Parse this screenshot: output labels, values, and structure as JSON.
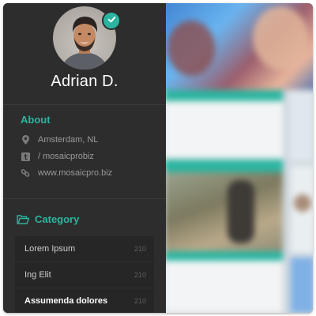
{
  "profile": {
    "name": "Adrian D.",
    "verified": true
  },
  "about": {
    "title": "About",
    "items": [
      {
        "icon": "map-pin-icon",
        "text": "Amsterdam, NL"
      },
      {
        "icon": "tumblr-icon",
        "text": "/ mosaicprobiz"
      },
      {
        "icon": "link-icon",
        "text": "www.mosaicpro.biz"
      }
    ]
  },
  "category": {
    "title": "Category",
    "icon": "folder-open-icon",
    "items": [
      {
        "label": "Lorem Ipsum",
        "count": "210"
      },
      {
        "label": "Ing Elit",
        "count": "210"
      },
      {
        "label": "Assumenda dolores",
        "count": "210",
        "active": true
      }
    ]
  },
  "colors": {
    "accent": "#2bb5a0",
    "sidebar_bg": "#2d2d2d",
    "list_bg": "#262626"
  }
}
